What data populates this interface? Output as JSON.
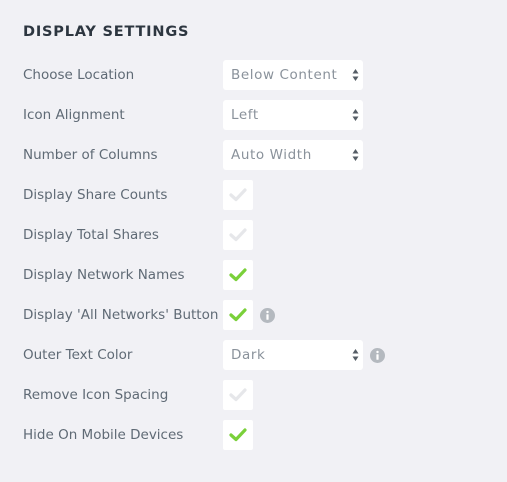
{
  "section": {
    "title": "DISPLAY SETTINGS"
  },
  "settings": [
    {
      "label": "Choose Location",
      "type": "select",
      "value": "Below Content",
      "info": false
    },
    {
      "label": "Icon Alignment",
      "type": "select",
      "value": "Left",
      "info": false
    },
    {
      "label": "Number of Columns",
      "type": "select",
      "value": "Auto Width",
      "info": false
    },
    {
      "label": "Display Share Counts",
      "type": "checkbox",
      "checked": false,
      "info": false
    },
    {
      "label": "Display Total Shares",
      "type": "checkbox",
      "checked": false,
      "info": false
    },
    {
      "label": "Display Network Names",
      "type": "checkbox",
      "checked": true,
      "info": false
    },
    {
      "label": "Display 'All Networks' Button",
      "type": "checkbox",
      "checked": true,
      "info": true
    },
    {
      "label": "Outer Text Color",
      "type": "select",
      "value": "Dark",
      "info": true
    },
    {
      "label": "Remove Icon Spacing",
      "type": "checkbox",
      "checked": false,
      "info": false
    },
    {
      "label": "Hide On Mobile Devices",
      "type": "checkbox",
      "checked": true,
      "info": false
    }
  ],
  "colors": {
    "background": "#f1f1f5",
    "check_on": "#7ad03a",
    "check_off": "#e6e7ea",
    "info_icon": "#b4b9bf"
  }
}
